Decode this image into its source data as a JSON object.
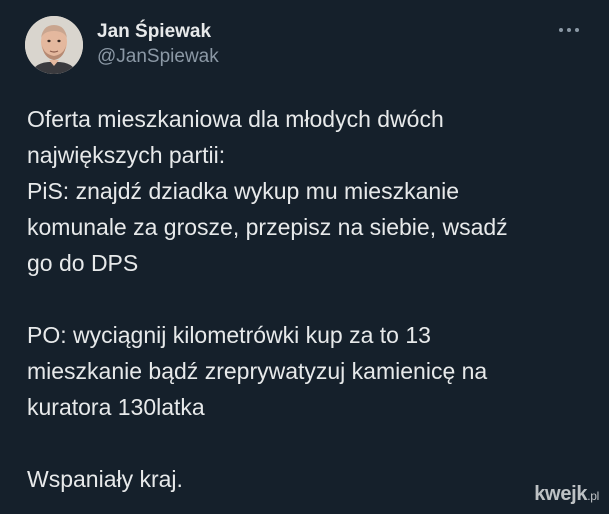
{
  "author": {
    "display_name": "Jan Śpiewak",
    "handle": "@JanSpiewak",
    "avatar": "profile-photo"
  },
  "more_icon": "more-horizontal-icon",
  "tweet": {
    "paragraphs": [
      [
        "Oferta mieszkaniowa dla młodych dwóch",
        "największych partii:",
        "PiS: znajdź dziadka wykup mu mieszkanie",
        "komunale za grosze, przepisz na siebie, wsadź",
        "go do DPS"
      ],
      [
        "PO: wyciągnij kilometrówki kup za to 13",
        "mieszkanie bądź zreprywatyzuj kamienicę na",
        "kuratora 130latka"
      ],
      [
        "Wspaniały kraj."
      ]
    ]
  },
  "watermark": {
    "brand": "kwejk",
    "suffix": ".pl"
  },
  "colors": {
    "background": "#15202b",
    "text": "#e7e9ea",
    "secondary_text": "#8b98a5"
  }
}
